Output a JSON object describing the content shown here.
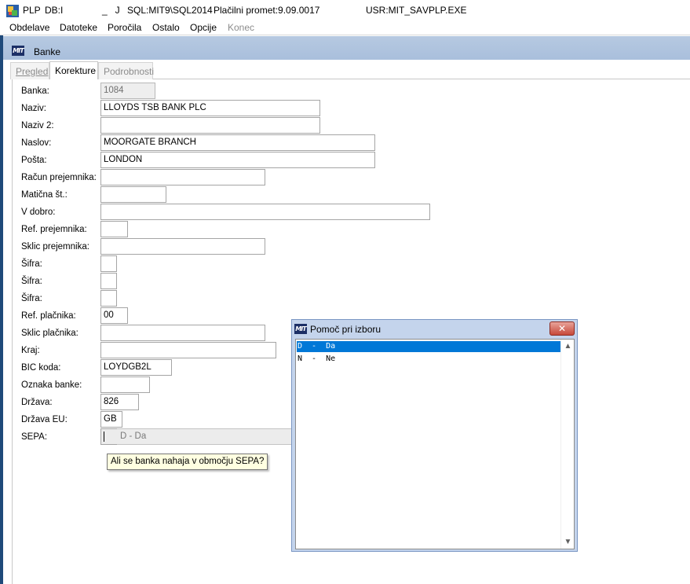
{
  "titlebar": {
    "app": "PLP",
    "db": "DB:I",
    "mid": "_   J",
    "sql": "SQL:MIT9\\SQL2014",
    "promet": "Plačilni promet:9.09.0017",
    "usr": "USR:MIT_SA",
    "exe": "VPLP.EXE"
  },
  "menu": {
    "items": [
      "Obdelave",
      "Datoteke",
      "Poročila",
      "Ostalo",
      "Opcije",
      "Konec"
    ]
  },
  "window": {
    "logo": "MIT",
    "title": "Banke"
  },
  "tabs": [
    "Pregled",
    "Korekture",
    "Podrobnosti"
  ],
  "form": {
    "labels": {
      "banka": "Banka:",
      "naziv": "Naziv:",
      "naziv2": "Naziv 2:",
      "naslov": "Naslov:",
      "posta": "Pošta:",
      "racun": "Račun prejemnika:",
      "maticna": "Matična št.:",
      "vdobro": "V dobro:",
      "refprej": "Ref. prejemnika:",
      "sklicprej": "Sklic prejemnika:",
      "sifra1": "Šifra:",
      "sifra2": "Šifra:",
      "sifra3": "Šifra:",
      "refplac": "Ref. plačnika:",
      "sklicplac": "Sklic plačnika:",
      "kraj": "Kraj:",
      "bic": "BIC koda:",
      "oznaka": "Oznaka banke:",
      "drzava": "Država:",
      "drzavaeu": "Država EU:",
      "sepa": "SEPA:"
    },
    "values": {
      "banka": "1084",
      "naziv": "LLOYDS TSB BANK PLC",
      "naziv2": "",
      "naslov": "MOORGATE BRANCH",
      "posta": "LONDON",
      "racun": "",
      "maticna": "",
      "vdobro": "",
      "refprej": "",
      "sklicprej": "",
      "sifra1": "",
      "sifra2": "",
      "sifra3": "",
      "refplac": "00",
      "sklicplac": "",
      "kraj": "",
      "bic": "LOYDGB2L",
      "oznaka": "",
      "drzava": "826",
      "drzavaeu": "GB",
      "sepa": "",
      "sepa_desc": "D - Da"
    },
    "tooltip": "Ali se banka nahaja v območju SEPA?"
  },
  "popup": {
    "logo": "MIT",
    "title": "Pomoč pri izboru",
    "close": "✕",
    "items": [
      "D  -  Da",
      "N  -  Ne"
    ],
    "scroll_up": "▲",
    "scroll_down": "▼"
  }
}
